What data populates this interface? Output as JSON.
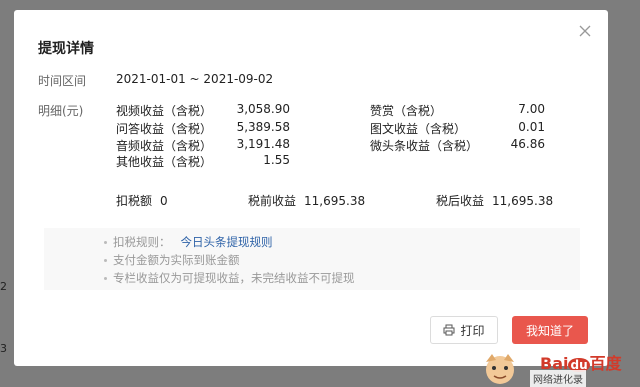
{
  "background": {
    "left_marks": [
      "2",
      "3"
    ]
  },
  "modal": {
    "title": "提现详情",
    "date_label": "时间区间",
    "date_range": "2021-01-01 ~ 2021-09-02",
    "detail_label": "明细(元)",
    "items_left": [
      {
        "name": "视频收益（含税）",
        "value": "3,058.90"
      },
      {
        "name": "问答收益（含税）",
        "value": "5,389.58"
      },
      {
        "name": "音频收益（含税）",
        "value": "3,191.48"
      },
      {
        "name": "其他收益（含税）",
        "value": "1.55"
      }
    ],
    "items_right": [
      {
        "name": "赞赏（含税）",
        "value": "7.00"
      },
      {
        "name": "图文收益（含税）",
        "value": "0.01"
      },
      {
        "name": "微头条收益（含税）",
        "value": "46.86"
      }
    ],
    "summary": {
      "tax_label": "扣税额",
      "tax_value": "0",
      "pretax_label": "税前收益",
      "pretax_value": "11,695.38",
      "aftertax_label": "税后收益",
      "aftertax_value": "11,695.38"
    },
    "rules": {
      "rule_label": "扣税规则：",
      "rule_link": "今日头条提现规则",
      "line2": "支付金额为实际到账金额",
      "line3": "专栏收益仅为可提现收益，未完结收益不可提现"
    },
    "print_button": "打印",
    "ok_button": "我知道了"
  },
  "watermark": {
    "logo_bai": "Bai",
    "logo_du": "du",
    "logo_cn": "百度",
    "caption": "网络进化录"
  },
  "colors": {
    "accent": "#e9574d",
    "link": "#2f63a8",
    "overlay": "#7d7d7d"
  },
  "icons": [
    "close-icon",
    "printer-icon"
  ]
}
